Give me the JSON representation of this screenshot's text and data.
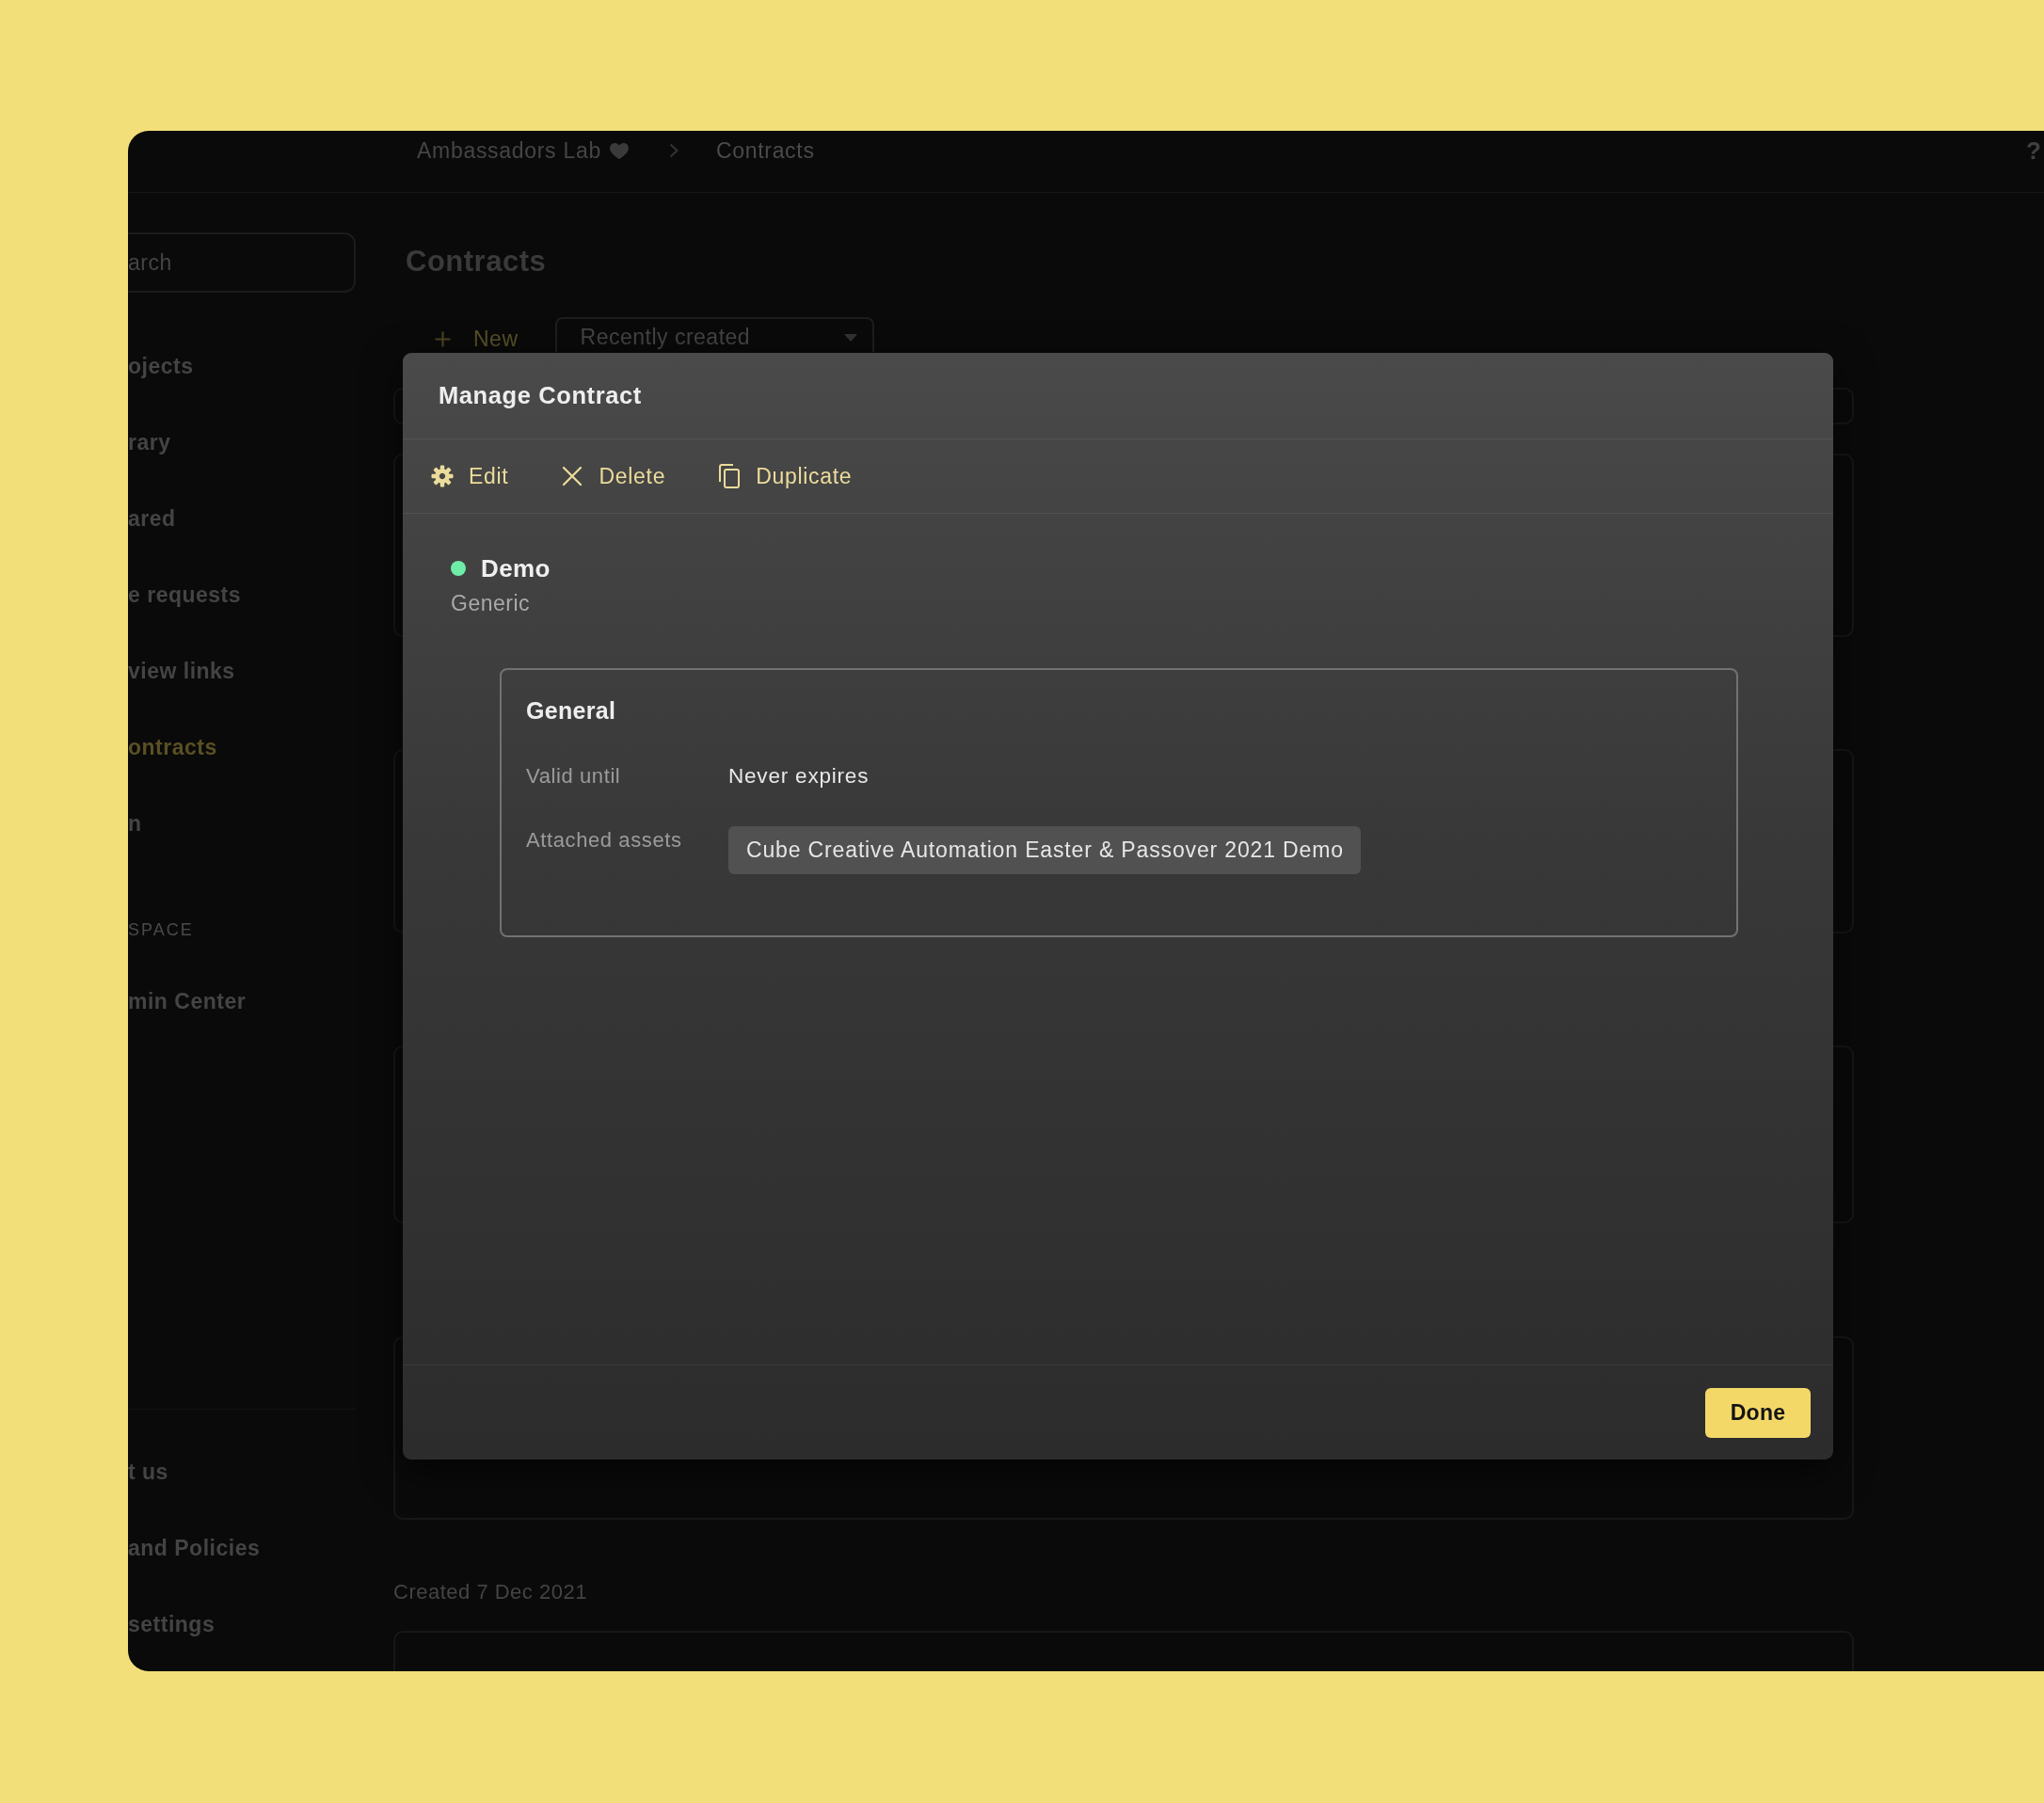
{
  "breadcrumb": [
    {
      "label": "Ambassadors Lab",
      "favorite": true
    },
    {
      "label": "Contracts",
      "favorite": false
    }
  ],
  "help": {
    "label": "?"
  },
  "sidebar": {
    "search": {
      "placeholder": "arch"
    },
    "items": [
      {
        "label": "ojects",
        "selected": false
      },
      {
        "label": "rary",
        "selected": false
      },
      {
        "label": "ared",
        "selected": false
      },
      {
        "label": "e requests",
        "selected": false
      },
      {
        "label": "view links",
        "selected": false
      },
      {
        "label": "ontracts",
        "selected": true
      },
      {
        "label": "n",
        "selected": false
      }
    ],
    "section": {
      "title": "SPACE",
      "items": [
        {
          "label": "min Center",
          "selected": false
        }
      ]
    },
    "footer_items": [
      {
        "label": "t us",
        "selected": false
      },
      {
        "label": "and Policies",
        "selected": false
      },
      {
        "label": "settings",
        "selected": false
      }
    ]
  },
  "page": {
    "title": "Contracts",
    "new_button": "New",
    "sort": {
      "value": "Recently created"
    },
    "group_label": "Created 7 Dec 2021"
  },
  "modal": {
    "title": "Manage Contract",
    "actions": [
      {
        "kind": "edit",
        "label": "Edit"
      },
      {
        "kind": "delete",
        "label": "Delete"
      },
      {
        "kind": "duplicate",
        "label": "Duplicate"
      }
    ],
    "contract": {
      "name": "Demo",
      "type": "Generic",
      "color": "#70eca9"
    },
    "section": {
      "title": "General",
      "fields": [
        {
          "kind": "text",
          "label": "Valid until",
          "value": "Never expires"
        },
        {
          "kind": "tags",
          "label": "Attached assets",
          "tags": [
            "Cube Creative Automation Easter & Passover 2021 Demo"
          ]
        }
      ]
    },
    "buttons": [
      {
        "kind": "primary",
        "label": "Done"
      }
    ]
  }
}
